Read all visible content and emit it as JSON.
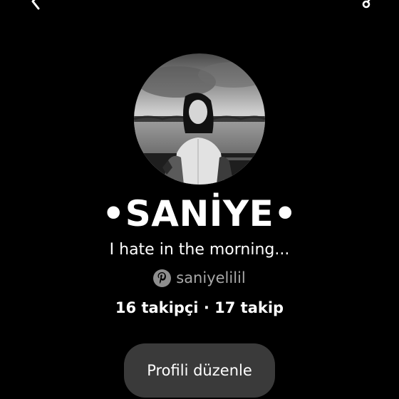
{
  "header": {
    "back_icon": "chevron-left-icon",
    "share_icon": "share-icon"
  },
  "profile": {
    "avatar_icon": "profile-photo",
    "display_name": "•SANİYE•",
    "bio": "I hate in the morning...",
    "username_icon": "pinterest-icon",
    "username": "saniyelilil",
    "followers_label": "16 takipçi",
    "separator": " · ",
    "following_label": "17 takip"
  },
  "actions": {
    "edit_profile_label": "Profili düzenle"
  },
  "colors": {
    "background": "#000000",
    "text_primary": "#ffffff",
    "text_secondary": "#a8a8a8",
    "button_bg": "#3a3a3a"
  }
}
